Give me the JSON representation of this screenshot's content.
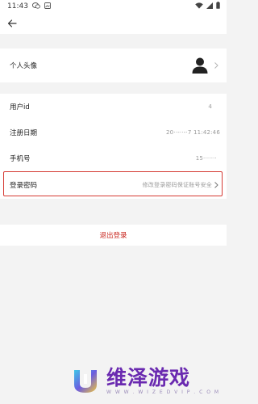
{
  "status_bar": {
    "time": "11:43",
    "icons": [
      "wechat-icon",
      "image-icon",
      "wifi-icon",
      "signal-icon",
      "battery-icon"
    ]
  },
  "profile": {
    "avatar_label": "个人头像",
    "account_rows": [
      {
        "label": "用户id",
        "value": "4"
      },
      {
        "label": "注册日期",
        "value": "20··-··-·7 11:42:46"
      },
      {
        "label": "手机号",
        "value": "15·······"
      }
    ],
    "password_row": {
      "label": "登录密码",
      "hint": "修改登录密码保证账号安全"
    }
  },
  "logout_label": "退出登录",
  "watermark": {
    "name": "维泽游戏",
    "sub": "W W W . W I Z E D V I P . C O M"
  },
  "colors": {
    "accent_red": "#c8261e",
    "highlight_border": "#d53a33",
    "brand_purple": "#6a2ab0"
  }
}
